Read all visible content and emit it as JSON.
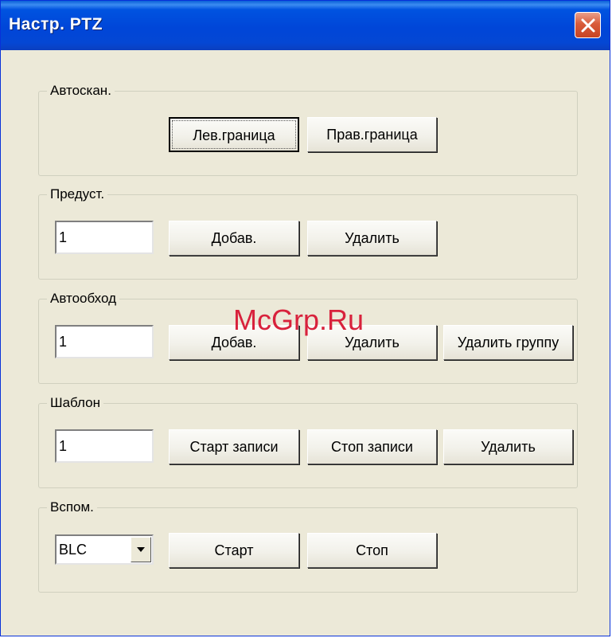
{
  "window": {
    "title": "Настр. PTZ",
    "close_icon": "close-icon"
  },
  "autoscan": {
    "title": "Автоскан.",
    "left_border_label": "Лев.граница",
    "right_border_label": "Прав.граница"
  },
  "preset": {
    "title": "Предуст.",
    "value": "1",
    "add_label": "Добав.",
    "delete_label": "Удалить"
  },
  "patrol": {
    "title": "Автообход",
    "value": "1",
    "add_label": "Добав.",
    "delete_label": "Удалить",
    "delete_group_label": "Удалить группу"
  },
  "pattern": {
    "title": "Шаблон",
    "value": "1",
    "start_record_label": "Старт записи",
    "stop_record_label": "Стоп записи",
    "delete_label": "Удалить"
  },
  "aux": {
    "title": "Вспом.",
    "selected": "BLC",
    "start_label": "Старт",
    "stop_label": "Стоп"
  },
  "watermark": "McGrp.Ru",
  "colors": {
    "titlebar": "#0046d8",
    "close_button": "#d95b3a",
    "dialog_bg": "#ece9d8"
  }
}
